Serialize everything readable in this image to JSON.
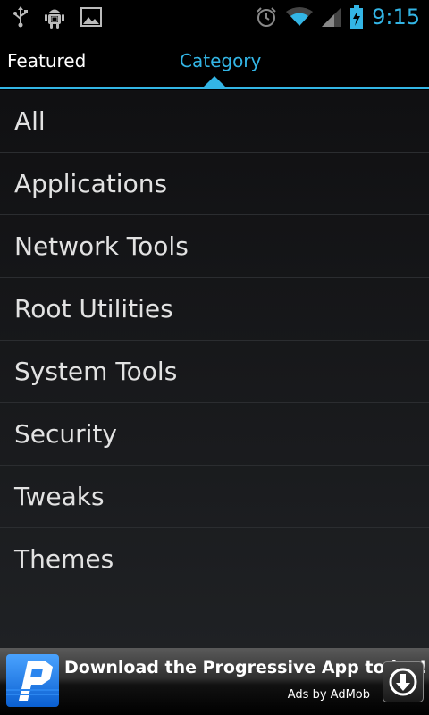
{
  "status_bar": {
    "time": "9:15",
    "icons": [
      "usb-icon",
      "android-debug-icon",
      "image-icon",
      "alarm-icon",
      "wifi-icon",
      "signal-icon",
      "battery-charging-icon"
    ]
  },
  "tabs": [
    {
      "label": "Featured",
      "selected": false
    },
    {
      "label": "Category",
      "selected": true
    }
  ],
  "accent_color": "#33b5e5",
  "categories": [
    "All",
    "Applications",
    "Network Tools",
    "Root Utilities",
    "System Tools",
    "Security",
    "Tweaks",
    "Themes"
  ],
  "ad": {
    "title": "Download the Progressive App today!",
    "subtitle": "Ads by AdMob",
    "logo_icon": "progressive-logo-icon",
    "action_icon": "download-arrow-icon"
  }
}
